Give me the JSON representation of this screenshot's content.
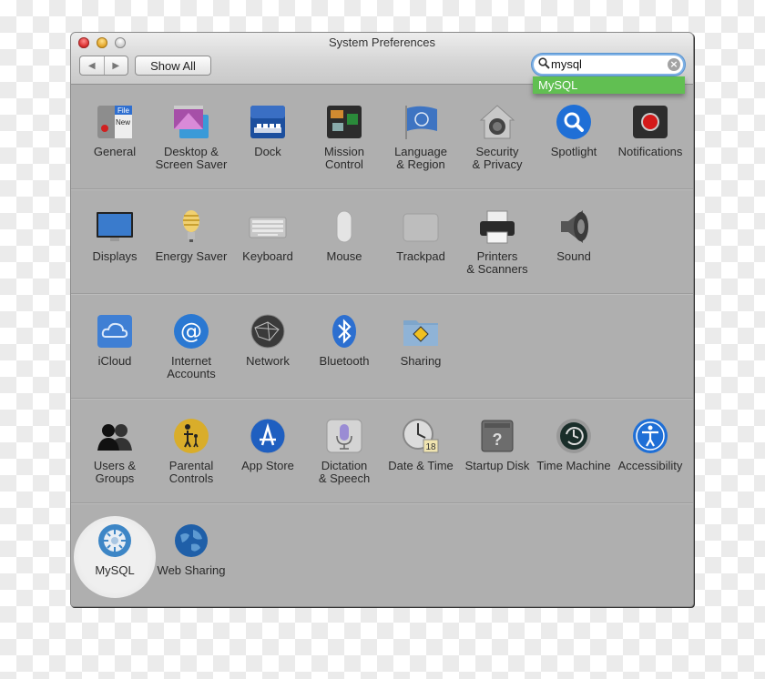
{
  "window": {
    "title": "System Preferences",
    "nav": {
      "back_icon": "◀",
      "forward_icon": "▶"
    },
    "show_all_label": "Show All",
    "search": {
      "value": "mysql",
      "icon": "⚲",
      "clear_icon": "×"
    },
    "suggestion": "MySQL"
  },
  "sections": [
    {
      "panes": [
        {
          "label": "General",
          "icon": "general-icon"
        },
        {
          "label": "Desktop & Screen Saver",
          "icon": "desktop-icon"
        },
        {
          "label": "Dock",
          "icon": "dock-icon"
        },
        {
          "label": "Mission Control",
          "icon": "mission-control-icon"
        },
        {
          "label": "Language & Region",
          "icon": "flag-icon"
        },
        {
          "label": "Security & Privacy",
          "icon": "security-icon"
        },
        {
          "label": "Spotlight",
          "icon": "spotlight-icon"
        },
        {
          "label": "Notifications",
          "icon": "notifications-icon"
        }
      ]
    },
    {
      "panes": [
        {
          "label": "Displays",
          "icon": "display-icon"
        },
        {
          "label": "Energy Saver",
          "icon": "bulb-icon"
        },
        {
          "label": "Keyboard",
          "icon": "keyboard-icon"
        },
        {
          "label": "Mouse",
          "icon": "mouse-icon"
        },
        {
          "label": "Trackpad",
          "icon": "trackpad-icon"
        },
        {
          "label": "Printers & Scanners",
          "icon": "printer-icon"
        },
        {
          "label": "Sound",
          "icon": "speaker-icon"
        }
      ]
    },
    {
      "panes": [
        {
          "label": "iCloud",
          "icon": "icloud-icon"
        },
        {
          "label": "Internet Accounts",
          "icon": "at-icon"
        },
        {
          "label": "Network",
          "icon": "network-icon"
        },
        {
          "label": "Bluetooth",
          "icon": "bluetooth-icon"
        },
        {
          "label": "Sharing",
          "icon": "sharing-folder-icon"
        }
      ]
    },
    {
      "panes": [
        {
          "label": "Users & Groups",
          "icon": "users-icon"
        },
        {
          "label": "Parental Controls",
          "icon": "parental-icon"
        },
        {
          "label": "App Store",
          "icon": "app-store-icon"
        },
        {
          "label": "Dictation & Speech",
          "icon": "microphone-icon"
        },
        {
          "label": "Date & Time",
          "icon": "clock-icon",
          "badge": "18"
        },
        {
          "label": "Startup Disk",
          "icon": "disk-icon",
          "badge": "?"
        },
        {
          "label": "Time Machine",
          "icon": "time-machine-icon"
        },
        {
          "label": "Accessibility",
          "icon": "accessibility-icon"
        }
      ]
    },
    {
      "panes": [
        {
          "label": "MySQL",
          "icon": "mysql-icon",
          "highlighted": true
        },
        {
          "label": "Web Sharing",
          "icon": "globe-icon"
        }
      ]
    }
  ]
}
